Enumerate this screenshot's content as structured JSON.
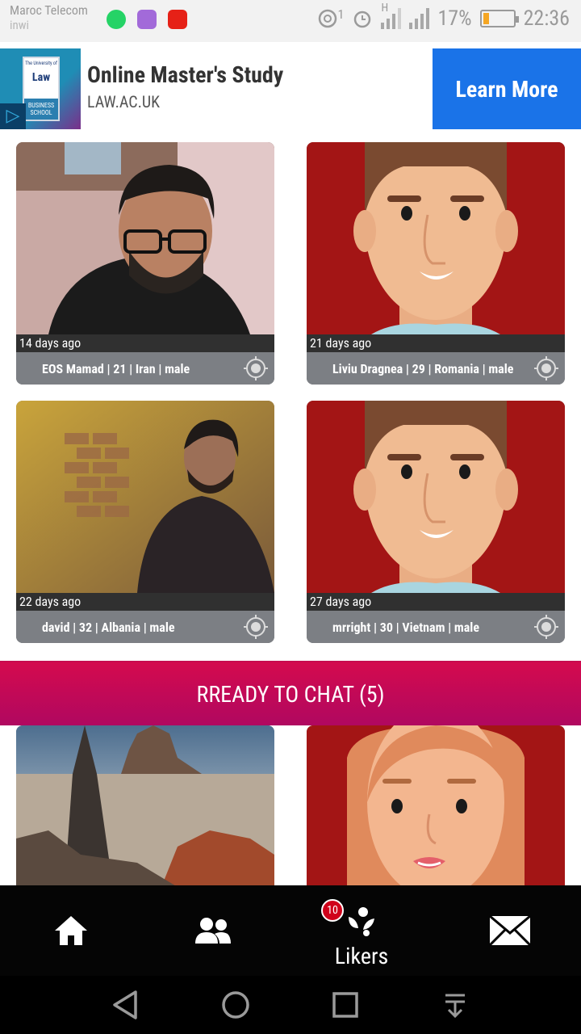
{
  "status": {
    "carrier_primary": "Maroc Telecom",
    "carrier_secondary": "inwi",
    "battery": "17%",
    "time": "22:36",
    "sim_index": "1",
    "net_type": "H"
  },
  "ad": {
    "logo_top": "The University of",
    "logo_main": "Law",
    "logo_bottom": "BUSINESS SCHOOL",
    "title": "Online Master's Study",
    "url": "LAW.AC.UK",
    "cta": "Learn More"
  },
  "cards": [
    {
      "time": "14 days ago",
      "info": "EOS Mamad | 21 | Iran | male"
    },
    {
      "time": "21 days ago",
      "info": "Liviu Dragnea | 29 | Romania | male"
    },
    {
      "time": "22 days ago",
      "info": "david | 32 | Albania | male"
    },
    {
      "time": "27 days ago",
      "info": "mrright | 30 | Vietnam | male"
    }
  ],
  "ready_banner": "RREADY TO CHAT (5)",
  "nav": {
    "likers_label": "Likers",
    "likers_badge": "10"
  },
  "colors": {
    "accent": "#c60b4f",
    "ad_cta": "#1a73e8",
    "avatar_bg": "#a31515"
  },
  "icons": [
    "home-icon",
    "people-icon",
    "likers-icon",
    "mail-icon",
    "location-target-icon",
    "back-icon",
    "home-circle-icon",
    "recents-icon",
    "download-icon"
  ]
}
